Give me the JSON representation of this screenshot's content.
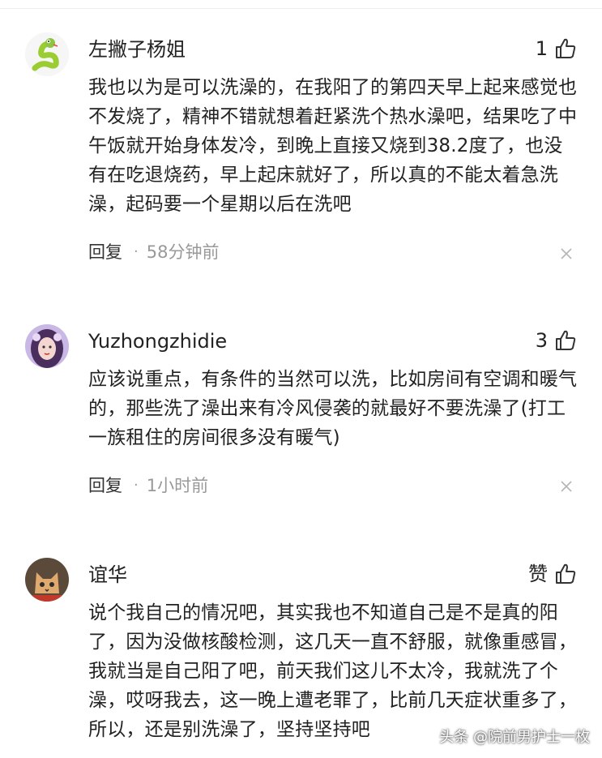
{
  "comments": [
    {
      "username": "左撇子杨姐",
      "likes": "1",
      "avatar": "snake-avatar",
      "text": "我也以为是可以洗澡的，在我阳了的第四天早上起来感觉也不发烧了，精神不错就想着赶紧洗个热水澡吧，结果吃了中午饭就开始身体发冷，到晚上直接又烧到38.2度了，也没有在吃退烧药，早上起床就好了，所以真的不能太着急洗澡，起码要一个星期以后在洗吧",
      "reply_label": "回复",
      "separator": "·",
      "time": "58分钟前"
    },
    {
      "username": "Yuzhongzhidie",
      "likes": "3",
      "avatar": "woman-avatar",
      "text": "应该说重点，有条件的当然可以洗，比如房间有空调和暖气的，那些洗了澡出来有冷风侵袭的就最好不要洗澡了(打工一族租住的房间很多没有暖气)",
      "reply_label": "回复",
      "separator": "·",
      "time": "1小时前"
    },
    {
      "username": "谊华",
      "likes": "赞",
      "avatar": "cat-avatar",
      "text": "说个我自己的情况吧，其实我也不知道自己是不是真的阳了，因为没做核酸检测，这几天一直不舒服，就像重感冒，我就当是自己阳了吧，前天我们这儿不太冷，我就洗了个澡，哎呀我去，这一晚上遭老罪了，比前几天症状重多了，所以，还是别洗澡了，坚持坚持吧"
    }
  ],
  "watermark": "头条 @院前男护士一枚",
  "icons": {
    "like": "thumbs-up-icon",
    "close": "close-icon"
  },
  "colors": {
    "text": "#222222",
    "meta": "#999999",
    "icon": "#333333"
  }
}
